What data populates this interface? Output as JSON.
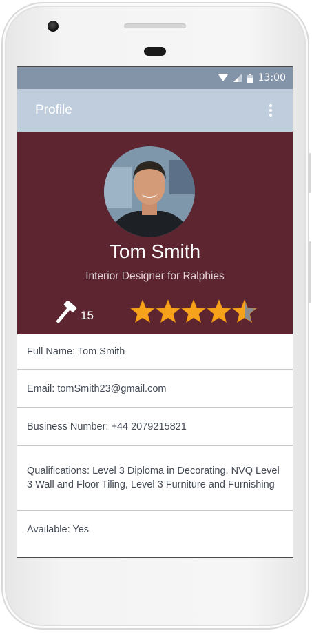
{
  "status_bar": {
    "time": "13:00"
  },
  "app_bar": {
    "title": "Profile"
  },
  "profile": {
    "name": "Tom Smith",
    "headline": "Interior Designer for Ralphies",
    "jobs_completed": "15",
    "rating": 4.5,
    "rating_max": 5
  },
  "details": [
    {
      "text": "Full Name: Tom Smith"
    },
    {
      "text": "Email: tomSmith23@gmail.com"
    },
    {
      "text": "Business Number: +44 2079215821"
    },
    {
      "text": "Qualifications: Level 3 Diploma in Decorating, NVQ Level 3 Wall and Floor Tiling, Level 3 Furniture and Furnishing"
    },
    {
      "text": "Available: Yes"
    }
  ],
  "colors": {
    "status_bar": "#8494a8",
    "app_bar": "#bfcddd",
    "header": "#5c2530",
    "star_fill": "#f7a21b",
    "star_empty": "#8b8b93"
  },
  "icons": [
    "wifi-icon",
    "signal-icon",
    "battery-icon",
    "overflow-menu-icon",
    "hammer-icon",
    "star-icon"
  ]
}
